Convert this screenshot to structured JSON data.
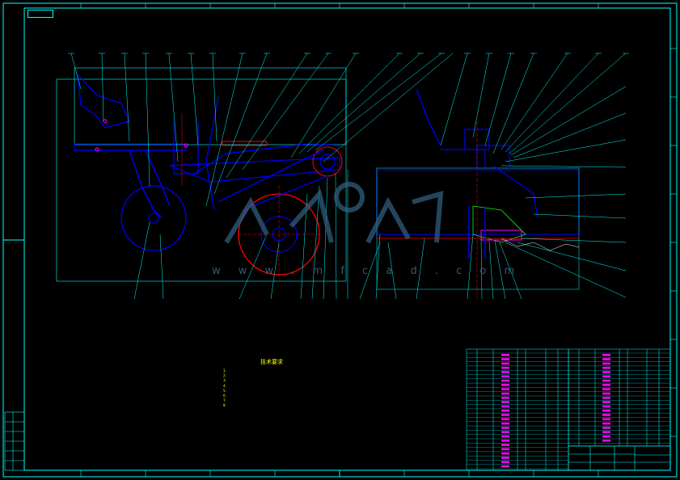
{
  "drawing": {
    "title_tag": "",
    "watermark_text": "w w w . m f c a d . c o m",
    "technical_notes_heading": "技术要求",
    "technical_notes": [
      "1.",
      "2.",
      "3.",
      "",
      "4.",
      "5.",
      "",
      "6.",
      "",
      "7.",
      "8."
    ],
    "title_block": {
      "name": "",
      "drawing_code": ""
    },
    "colors": {
      "background": "#000000",
      "frame": "#00ffff",
      "part_outline": "#0000ff",
      "leader": "#00ffff",
      "centerline": "#ff0000",
      "dimension": "#00ff00",
      "text": "#ffffff",
      "notes": "#ffff00",
      "magenta": "#ff00ff"
    },
    "icons": [
      "watermark-logo-icon"
    ]
  }
}
